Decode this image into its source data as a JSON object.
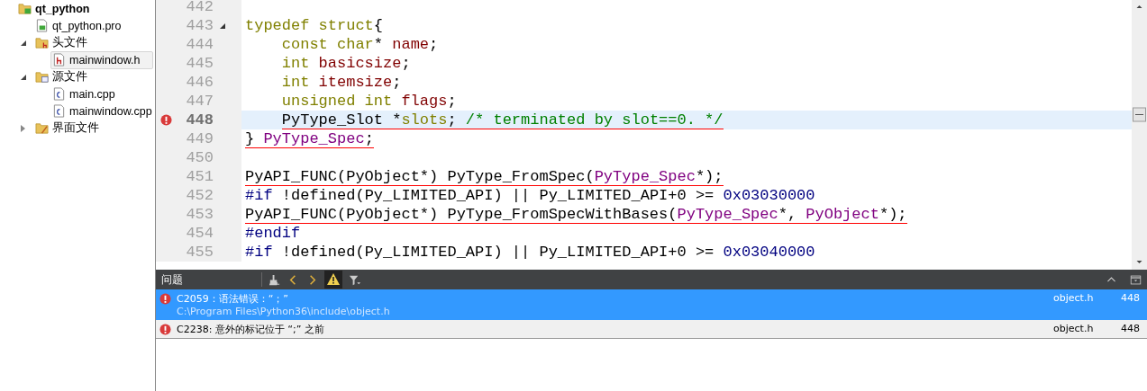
{
  "project_tree": [
    {
      "label": "qt_python",
      "kind": "project",
      "selected": false,
      "children": [
        {
          "label": "qt_python.pro",
          "kind": "profile",
          "selected": false
        },
        {
          "label": "头文件",
          "kind": "headers",
          "expanded": true,
          "selected": false,
          "children": [
            {
              "label": "mainwindow.h",
              "kind": "header",
              "selected": true
            }
          ]
        },
        {
          "label": "源文件",
          "kind": "sources",
          "expanded": true,
          "selected": false,
          "children": [
            {
              "label": "main.cpp",
              "kind": "source",
              "selected": false
            },
            {
              "label": "mainwindow.cpp",
              "kind": "source",
              "selected": false
            }
          ]
        },
        {
          "label": "界面文件",
          "kind": "forms",
          "expanded": false,
          "selected": false
        }
      ]
    }
  ],
  "editor": {
    "lines": [
      {
        "number": "442",
        "current": false,
        "error": false,
        "fold": false
      },
      {
        "number": "443",
        "current": false,
        "error": false,
        "fold": true,
        "squiggle": false,
        "tokens": [
          {
            "kind": "keyword",
            "text": "typedef struct"
          },
          {
            "kind": "plain",
            "text": "{"
          }
        ]
      },
      {
        "number": "444",
        "current": false,
        "error": false,
        "fold": false,
        "squiggle": false,
        "indented": true,
        "tokens": [
          {
            "kind": "keyword",
            "text": "const char"
          },
          {
            "kind": "plain",
            "text": "* "
          },
          {
            "kind": "field",
            "text": "name"
          },
          {
            "kind": "plain",
            "text": ";"
          }
        ]
      },
      {
        "number": "445",
        "current": false,
        "error": false,
        "fold": false,
        "squiggle": false,
        "indented": true,
        "tokens": [
          {
            "kind": "keyword",
            "text": "int "
          },
          {
            "kind": "field",
            "text": "basicsize"
          },
          {
            "kind": "plain",
            "text": ";"
          }
        ]
      },
      {
        "number": "446",
        "current": false,
        "error": false,
        "fold": false,
        "squiggle": false,
        "indented": true,
        "tokens": [
          {
            "kind": "keyword",
            "text": "int "
          },
          {
            "kind": "field",
            "text": "itemsize"
          },
          {
            "kind": "plain",
            "text": ";"
          }
        ]
      },
      {
        "number": "447",
        "current": false,
        "error": false,
        "fold": false,
        "squiggle": false,
        "indented": true,
        "tokens": [
          {
            "kind": "keyword",
            "text": "unsigned int "
          },
          {
            "kind": "field",
            "text": "flags"
          },
          {
            "kind": "plain",
            "text": ";"
          }
        ]
      },
      {
        "number": "448",
        "current": true,
        "error": true,
        "fold": false,
        "squiggle": true,
        "indented": true,
        "tokens": [
          {
            "kind": "plain",
            "text": "PyType_Slot *"
          },
          {
            "kind": "keyword",
            "text": "slots"
          },
          {
            "kind": "plain",
            "text": "; "
          },
          {
            "kind": "comment",
            "text": "/* terminated by slot==0. */"
          }
        ]
      },
      {
        "number": "449",
        "current": false,
        "error": false,
        "fold": false,
        "squiggle": true,
        "tokens": [
          {
            "kind": "plain",
            "text": "} "
          },
          {
            "kind": "type",
            "text": "PyType_Spec"
          },
          {
            "kind": "plain",
            "text": ";"
          }
        ]
      },
      {
        "number": "450",
        "current": false,
        "error": false,
        "fold": false
      },
      {
        "number": "451",
        "current": false,
        "error": false,
        "fold": false,
        "squiggle": true,
        "tokens": [
          {
            "kind": "plain",
            "text": "PyAPI_FUNC(PyObject*) PyType_FromSpec("
          },
          {
            "kind": "type",
            "text": "PyType_Spec"
          },
          {
            "kind": "plain",
            "text": "*);"
          }
        ]
      },
      {
        "number": "452",
        "current": false,
        "error": false,
        "fold": false,
        "squiggle": false,
        "tokens": [
          {
            "kind": "preproc",
            "text": "#if "
          },
          {
            "kind": "plain",
            "text": "!defined(Py_LIMITED_API) || Py_LIMITED_API+0 >= "
          },
          {
            "kind": "number",
            "text": "0x03030000"
          }
        ]
      },
      {
        "number": "453",
        "current": false,
        "error": false,
        "fold": false,
        "squiggle": true,
        "tokens": [
          {
            "kind": "plain",
            "text": "PyAPI_FUNC(PyObject*) PyType_FromSpecWithBases("
          },
          {
            "kind": "type",
            "text": "PyType_Spec"
          },
          {
            "kind": "plain",
            "text": "*, "
          },
          {
            "kind": "type",
            "text": "PyObject"
          },
          {
            "kind": "plain",
            "text": "*);"
          }
        ]
      },
      {
        "number": "454",
        "current": false,
        "error": false,
        "fold": false,
        "squiggle": false,
        "tokens": [
          {
            "kind": "preproc",
            "text": "#endif"
          }
        ]
      },
      {
        "number": "455",
        "current": false,
        "error": false,
        "fold": false,
        "squiggle": false,
        "tokens": [
          {
            "kind": "preproc",
            "text": "#if "
          },
          {
            "kind": "plain",
            "text": "!defined(Py_LIMITED_API) || Py_LIMITED_API+0 >= "
          },
          {
            "kind": "number",
            "text": "0x03040000"
          }
        ]
      }
    ]
  },
  "issues_panel": {
    "title": "问题",
    "rows": [
      {
        "kind": "error",
        "selected": true,
        "message": "C2059：语法错误：“；”",
        "path": "C:\\Program Files\\Python36\\include\\object.h",
        "file": "object.h",
        "line": "448"
      },
      {
        "kind": "error",
        "selected": false,
        "message": "C2238: 意外的标记位于 “;” 之前",
        "file": "object.h",
        "line": "448"
      }
    ]
  }
}
